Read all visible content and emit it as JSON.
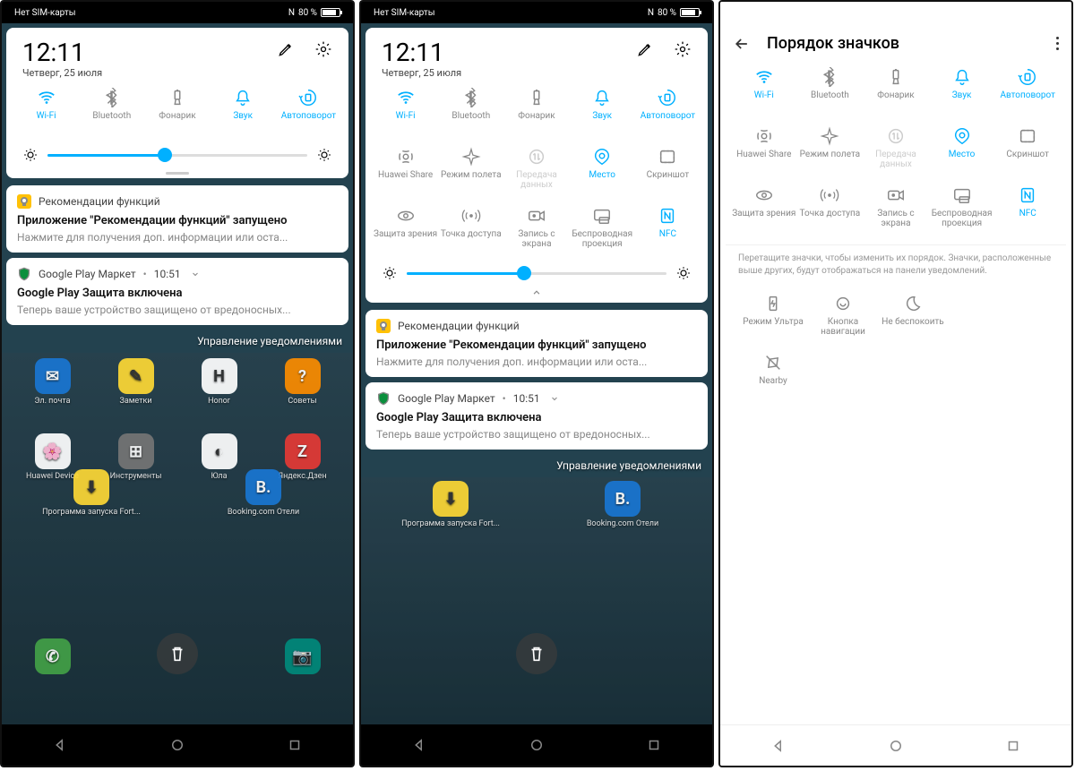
{
  "status": {
    "sim": "Нет SIM-карты",
    "nfc": "N",
    "battery_pct": "80 %"
  },
  "panel": {
    "time": "12:11",
    "date": "Четверг, 25 июля"
  },
  "qs": {
    "wifi": "Wi-Fi",
    "bt": "Bluetooth",
    "flash": "Фонарик",
    "sound": "Звук",
    "rotate": "Автоповорот",
    "huawei_share": "Huawei Share",
    "airplane": "Режим полета",
    "data": "Передача данных",
    "location": "Место",
    "screenshot": "Скриншот",
    "eye": "Защита зрения",
    "hotspot": "Точка доступа",
    "screenrec": "Запись с экрана",
    "cast": "Беспроводная проекция",
    "nfc": "NFC"
  },
  "notif1": {
    "source": "Рекомендации функций",
    "title": "Приложение \"Рекомендации функций\" запущено",
    "sub": "Нажмите для получения доп. информации или оста..."
  },
  "notif2": {
    "source": "Google Play Маркет",
    "time": "10:51",
    "title": "Google Play Защита включена",
    "sub": "Теперь ваше устройство защищено от вредоносных..."
  },
  "manage": "Управление уведомлениями",
  "apps": {
    "mail": "Эл. почта",
    "notes": "Заметки",
    "honor": "Honor",
    "tips": "Советы",
    "huawei_dev": "Huawei Device",
    "tools": "Инструменты",
    "yula": "Юла",
    "dzen": "Яндекс.Дзен",
    "fort": "Программа запуска Fort...",
    "booking": "Booking.com Отели",
    "booking_s": "Booking"
  },
  "screen3": {
    "title": "Порядок значков",
    "hint": "Перетащите значки, чтобы изменить их порядок. Значки, расположенные выше других, будут отображаться на панели уведомлений.",
    "ultra": "Режим Ультра",
    "navbtn": "Кнопка навигации",
    "dnd": "Не беспокоить",
    "nearby": "Nearby"
  }
}
